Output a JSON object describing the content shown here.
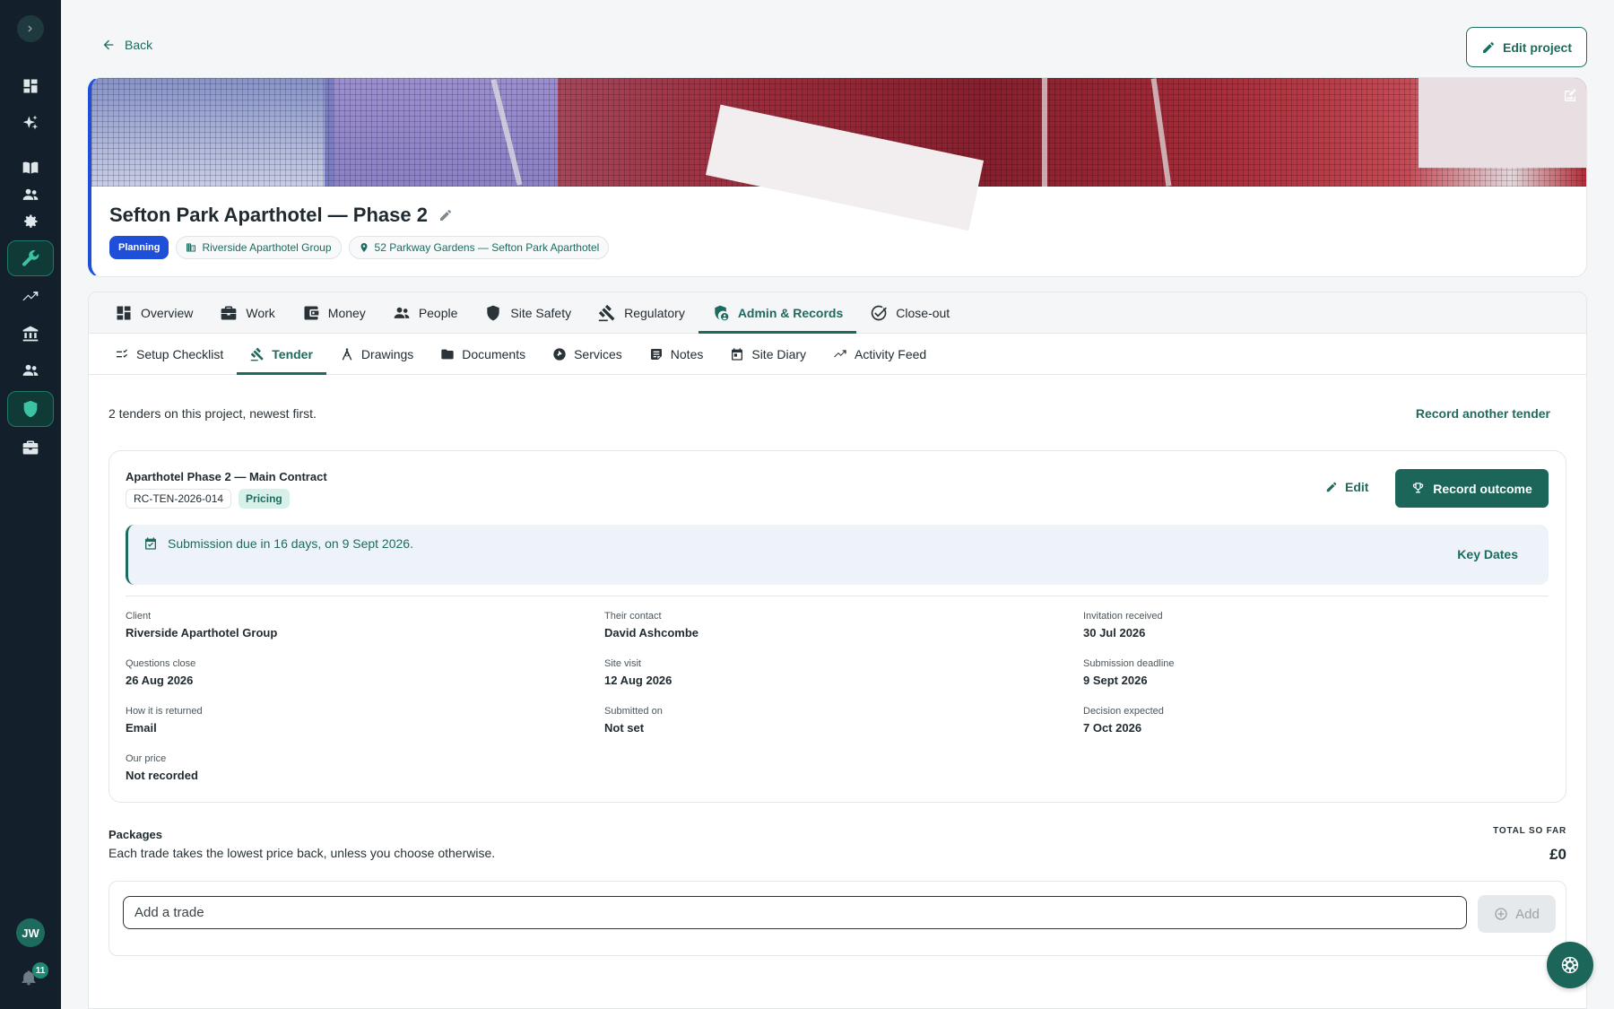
{
  "nav": {
    "back_label": "Back",
    "edit_project_label": "Edit project",
    "user_initials": "JW",
    "notification_count": "11"
  },
  "project": {
    "title": "Sefton Park Aparthotel — Phase 2",
    "status": "Planning",
    "client": "Riverside Aparthotel Group",
    "address": "52 Parkway Gardens — Sefton Park Aparthotel"
  },
  "tabs": [
    {
      "label": "Overview",
      "icon": "dashboard-icon"
    },
    {
      "label": "Work",
      "icon": "briefcase-icon"
    },
    {
      "label": "Money",
      "icon": "wallet-icon"
    },
    {
      "label": "People",
      "icon": "people-icon"
    },
    {
      "label": "Site Safety",
      "icon": "shield-icon"
    },
    {
      "label": "Regulatory",
      "icon": "gavel-icon"
    },
    {
      "label": "Admin & Records",
      "icon": "admin-shield-icon",
      "active": true
    },
    {
      "label": "Close-out",
      "icon": "check-circle-icon"
    }
  ],
  "subtabs": [
    {
      "label": "Setup Checklist",
      "icon": "checklist-icon"
    },
    {
      "label": "Tender",
      "icon": "gavel-icon",
      "active": true
    },
    {
      "label": "Drawings",
      "icon": "compass-icon"
    },
    {
      "label": "Documents",
      "icon": "folder-icon"
    },
    {
      "label": "Services",
      "icon": "services-icon"
    },
    {
      "label": "Notes",
      "icon": "note-icon"
    },
    {
      "label": "Site Diary",
      "icon": "calendar-icon"
    },
    {
      "label": "Activity Feed",
      "icon": "trend-icon"
    }
  ],
  "tender_list": {
    "summary": "2 tenders on this project, newest first.",
    "record_another_label": "Record another tender"
  },
  "tender": {
    "name": "Aparthotel Phase 2 — Main Contract",
    "reference": "RC-TEN-2026-014",
    "stage": "Pricing",
    "edit_label": "Edit",
    "record_outcome_label": "Record outcome",
    "due_text": "Submission due in 16 days, on 9 Sept 2026.",
    "key_dates_label": "Key Dates",
    "fields": {
      "client": {
        "label": "Client",
        "value": "Riverside Aparthotel Group"
      },
      "contact": {
        "label": "Their contact",
        "value": "David Ashcombe"
      },
      "invitation": {
        "label": "Invitation received",
        "value": "30 Jul 2026"
      },
      "questions_close": {
        "label": "Questions close",
        "value": "26 Aug 2026"
      },
      "site_visit": {
        "label": "Site visit",
        "value": "12 Aug 2026"
      },
      "deadline": {
        "label": "Submission deadline",
        "value": "9 Sept 2026"
      },
      "return_method": {
        "label": "How it is returned",
        "value": "Email"
      },
      "submitted_on": {
        "label": "Submitted on",
        "value": "Not set"
      },
      "decision": {
        "label": "Decision expected",
        "value": "7 Oct 2026"
      },
      "our_price": {
        "label": "Our price",
        "value": "Not recorded"
      }
    }
  },
  "packages": {
    "title": "Packages",
    "subtitle": "Each trade takes the lowest price back, unless you choose otherwise.",
    "total_label": "TOTAL SO FAR",
    "total_value": "£0",
    "add_placeholder": "Add a trade",
    "add_label": "Add"
  },
  "colors": {
    "brand": "#1d6b5e",
    "sidebar": "#13202b",
    "status_blue": "#1f4fd8"
  }
}
